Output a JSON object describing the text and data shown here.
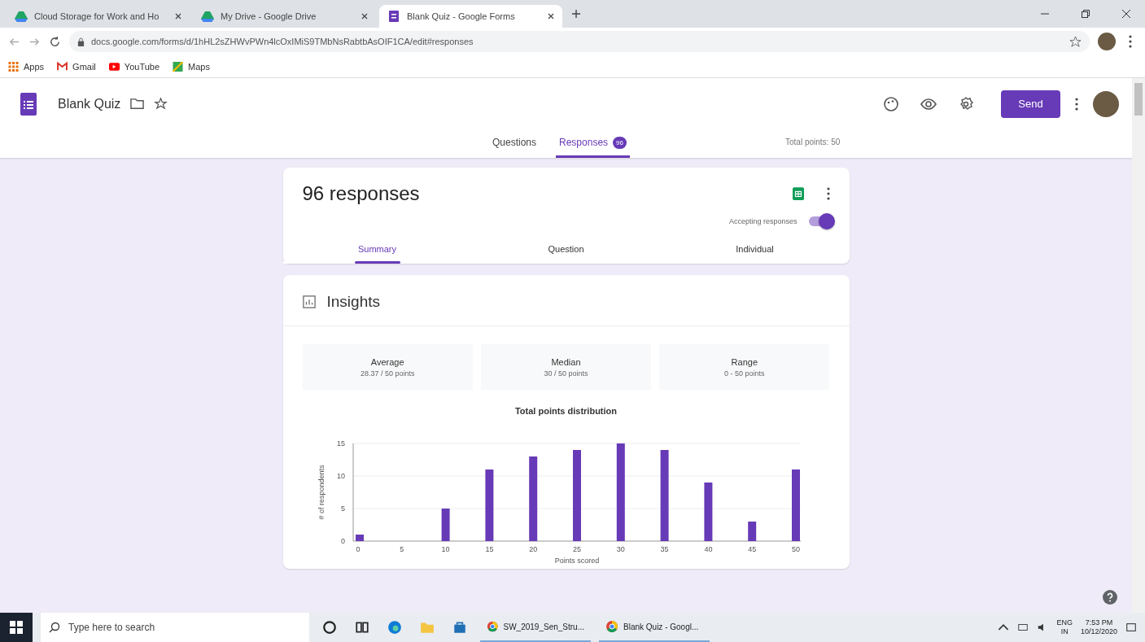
{
  "browser": {
    "tabs": [
      {
        "title": "Cloud Storage for Work and Ho",
        "selected": false,
        "kind": "drive"
      },
      {
        "title": "My Drive - Google Drive",
        "selected": false,
        "kind": "drive"
      },
      {
        "title": "Blank Quiz - Google Forms",
        "selected": true,
        "kind": "forms"
      }
    ],
    "url": "docs.google.com/forms/d/1hHL2sZHWvPWn4lcOxIMiS9TMbNsRabtbAsOIF1CA/edit#responses",
    "bookmarks": [
      {
        "label": "Apps",
        "kind": "apps"
      },
      {
        "label": "Gmail",
        "kind": "gmail"
      },
      {
        "label": "YouTube",
        "kind": "youtube"
      },
      {
        "label": "Maps",
        "kind": "maps"
      }
    ]
  },
  "form": {
    "title": "Blank Quiz",
    "send_label": "Send",
    "tabs": [
      {
        "label": "Questions",
        "selected": false
      },
      {
        "label": "Responses",
        "selected": true,
        "badge": "96"
      }
    ],
    "total_points": "Total points: 50"
  },
  "responses": {
    "heading": "96 responses",
    "accepting_label": "Accepting responses",
    "accepting": true,
    "tabs": [
      {
        "label": "Summary",
        "selected": true
      },
      {
        "label": "Question",
        "selected": false
      },
      {
        "label": "Individual",
        "selected": false
      }
    ]
  },
  "insights": {
    "title": "Insights",
    "stats": [
      {
        "label": "Average",
        "value": "28.37 / 50 points"
      },
      {
        "label": "Median",
        "value": "30 / 50 points"
      },
      {
        "label": "Range",
        "value": "0 - 50 points"
      }
    ],
    "chart_data": {
      "type": "bar",
      "title": "Total points distribution",
      "xlabel": "Points scored",
      "ylabel": "# of respondents",
      "categories": [
        "0",
        "5",
        "10",
        "15",
        "20",
        "25",
        "30",
        "35",
        "40",
        "45",
        "50"
      ],
      "series": [
        {
          "color": "#673ab7",
          "values": [
            1,
            0,
            5,
            11,
            13,
            14,
            15,
            14,
            9,
            3,
            11
          ]
        }
      ],
      "ylim": [
        0,
        15
      ],
      "yticks": [
        0,
        5,
        10,
        15
      ]
    }
  },
  "taskbar": {
    "search_placeholder": "Type here to search",
    "apps": [
      {
        "label": "SW_2019_Sen_Stru..."
      },
      {
        "label": "Blank Quiz - Googl..."
      }
    ],
    "language": [
      "ENG",
      "IN"
    ],
    "time": "7:53 PM",
    "date": "10/12/2020"
  }
}
